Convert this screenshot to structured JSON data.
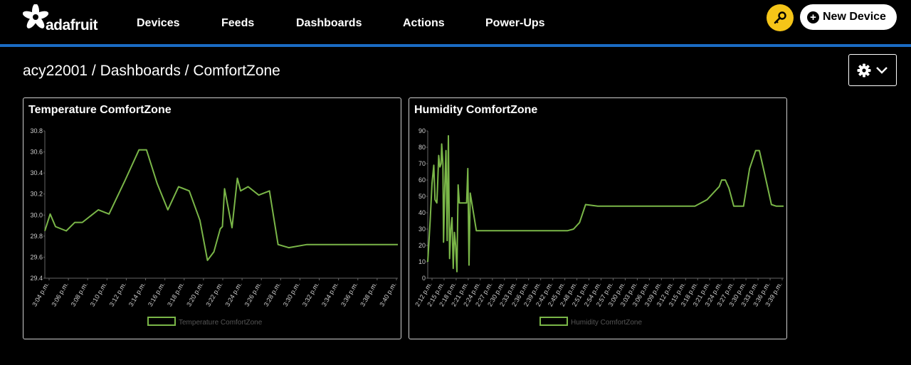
{
  "header": {
    "logo_text": "adafruit",
    "nav": [
      {
        "label": "Devices"
      },
      {
        "label": "Feeds"
      },
      {
        "label": "Dashboards"
      },
      {
        "label": "Actions"
      },
      {
        "label": "Power-Ups"
      }
    ],
    "new_device_label": "New Device",
    "key_icon": "key-icon",
    "accent_color": "#1a6bc4",
    "key_button_color": "#f5c518"
  },
  "breadcrumb": "acy22001 / Dashboards / ComfortZone",
  "chart_data": [
    {
      "type": "line",
      "title": "Temperature ComfortZone",
      "color": "#7ab648",
      "legend": "Temperature ComfortZone",
      "legend_position": "bottom",
      "ylim": [
        29.4,
        30.8
      ],
      "yticks": [
        "29.4",
        "29.6",
        "29.8",
        "30.0",
        "30.2",
        "30.4",
        "30.6",
        "30.8"
      ],
      "xticks": [
        "3:04 p.m.",
        "3:06 p.m.",
        "3:08 p.m.",
        "3:10 p.m.",
        "3:12 p.m.",
        "3:14 p.m.",
        "3:16 p.m.",
        "3:18 p.m.",
        "3:20 p.m.",
        "3:22 p.m.",
        "3:24 p.m.",
        "3:26 p.m.",
        "3:28 p.m.",
        "3:30 p.m.",
        "3:32 p.m.",
        "3:34 p.m.",
        "3:36 p.m.",
        "3:38 p.m.",
        "3:40 p.m."
      ],
      "x": [
        0,
        0.05,
        0.1,
        0.2,
        0.28,
        0.35,
        0.5,
        0.6,
        0.75,
        0.88,
        0.95,
        1.05,
        1.15,
        1.25,
        1.35,
        1.45,
        1.52,
        1.58,
        1.64,
        1.66,
        1.68,
        1.75,
        1.8,
        1.83,
        1.9,
        2.0,
        2.1,
        2.18,
        2.28,
        2.45,
        2.55,
        2.68,
        2.75,
        2.8,
        2.9,
        3.0,
        3.1,
        3.2,
        3.3
      ],
      "y": [
        29.85,
        30.01,
        29.89,
        29.85,
        29.93,
        29.93,
        30.05,
        30.01,
        30.33,
        30.62,
        30.62,
        30.3,
        30.05,
        30.27,
        30.23,
        29.95,
        29.57,
        29.65,
        29.87,
        29.89,
        30.25,
        29.88,
        30.35,
        30.23,
        30.27,
        30.19,
        30.23,
        29.72,
        29.69,
        29.72,
        29.72,
        29.72,
        29.72,
        29.72,
        29.72,
        29.72,
        29.72,
        29.72,
        29.72
      ],
      "grid": false
    },
    {
      "type": "line",
      "title": "Humidity ComfortZone",
      "color": "#7ab648",
      "legend": "Humidity ComfortZone",
      "legend_position": "bottom",
      "ylim": [
        0,
        90
      ],
      "yticks": [
        "0",
        "10",
        "20",
        "30",
        "40",
        "50",
        "60",
        "70",
        "80",
        "90"
      ],
      "xticks": [
        "2:12 p.m.",
        "2:15 p.m.",
        "2:18 p.m.",
        "2:21 p.m.",
        "2:24 p.m.",
        "2:27 p.m.",
        "2:30 p.m.",
        "2:33 p.m.",
        "2:36 p.m.",
        "2:39 p.m.",
        "2:42 p.m.",
        "2:45 p.m.",
        "2:48 p.m.",
        "2:51 p.m.",
        "2:54 p.m.",
        "2:57 p.m.",
        "3:00 p.m.",
        "3:03 p.m.",
        "3:06 p.m.",
        "3:09 p.m.",
        "3:12 p.m.",
        "3:15 p.m.",
        "3:18 p.m.",
        "3:21 p.m.",
        "3:24 p.m.",
        "3:27 p.m.",
        "3:30 p.m.",
        "3:33 p.m.",
        "3:36 p.m.",
        "3:39 p.m."
      ],
      "x": [
        0,
        0.2,
        0.35,
        0.5,
        0.6,
        0.75,
        0.8,
        0.9,
        1.0,
        1.1,
        1.15,
        1.25,
        1.3,
        1.4,
        1.5,
        1.6,
        1.7,
        1.8,
        1.9,
        2.0,
        2.1,
        2.2,
        2.3,
        2.4,
        2.5,
        2.6,
        2.7,
        2.8,
        2.9,
        3.0,
        3.1,
        3.2,
        3.3,
        3.4,
        3.5,
        4.0,
        4.5,
        5.0,
        6.0,
        7.0,
        8.0,
        9.0,
        10.0,
        10.5,
        11.0,
        11.5,
        12.0,
        12.5,
        13.0,
        14.0,
        15.0,
        16.0,
        17.0,
        18.0,
        19.0,
        20.0,
        21.0,
        22.0,
        23.0,
        24.0,
        24.2,
        24.5,
        24.8,
        25.2,
        25.6,
        26.0,
        26.5,
        27.0,
        27.3,
        27.7,
        28.0,
        28.3,
        28.7,
        29.0,
        29.3
      ],
      "y": [
        10,
        35,
        58,
        69,
        48,
        46,
        55,
        75,
        68,
        70,
        82,
        70,
        22,
        55,
        78,
        23,
        87,
        12,
        30,
        37,
        6,
        28,
        20,
        4,
        57,
        46,
        46,
        46,
        46,
        46,
        46,
        46,
        67,
        8,
        52,
        29,
        29,
        29,
        29,
        29,
        29,
        29,
        29,
        29,
        29,
        29,
        30,
        34,
        45,
        44,
        44,
        44,
        44,
        44,
        44,
        44,
        44,
        44,
        48,
        56,
        60,
        60,
        55,
        44,
        44,
        44,
        67,
        78,
        78,
        65,
        55,
        45,
        44,
        44,
        44
      ],
      "grid": false
    }
  ]
}
